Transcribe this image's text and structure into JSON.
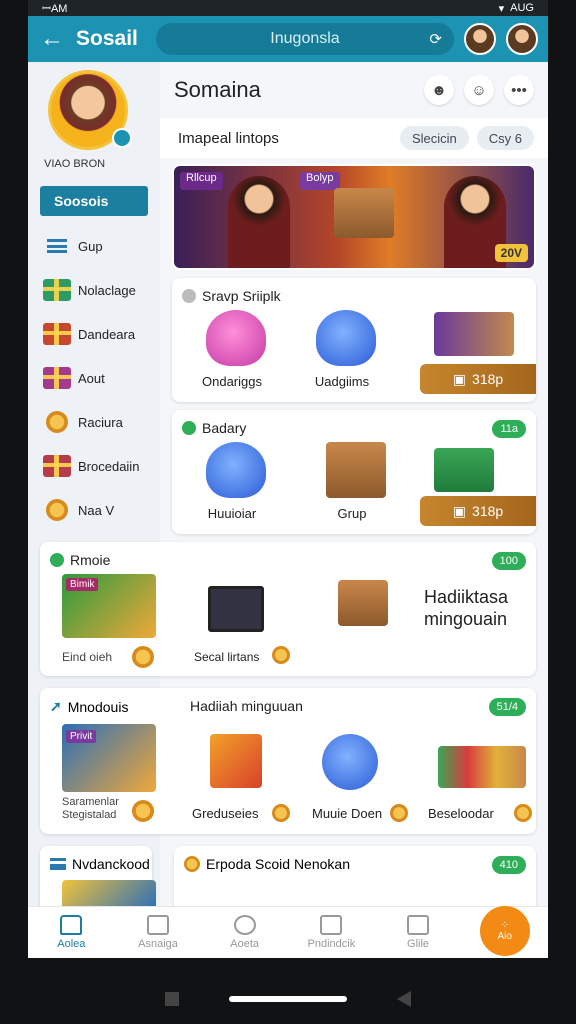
{
  "status": {
    "left": "ꟷAM",
    "right": "AUG"
  },
  "topbar": {
    "title": "Sosail",
    "search_text": "Inugonsla"
  },
  "sidebar": {
    "profile_name": "VIAO BRON",
    "selected": "Soosois",
    "items": [
      {
        "label": "Gup",
        "icon": "menu-icon"
      },
      {
        "label": "Nolaclage",
        "icon": "gift-icon",
        "color": "#2f9b64"
      },
      {
        "label": "Dandeara",
        "icon": "gift-icon",
        "color": "#c8482f"
      },
      {
        "label": "Aout",
        "icon": "gift-icon",
        "color": "#a33a8d"
      },
      {
        "label": "Raciura",
        "icon": "coin-icon",
        "color": "#e5a020"
      },
      {
        "label": "Brocedaiin",
        "icon": "gift-icon",
        "color": "#b73c4a"
      },
      {
        "label": "Naa V",
        "icon": "coin-icon",
        "color": "#e2a726"
      }
    ]
  },
  "main": {
    "title": "Somaina",
    "subhead_label": "Imapeal lintops",
    "pills": [
      "Slecicin",
      "Csy 6"
    ],
    "banner": {
      "tag1": "Rllcup",
      "tag2": "Bolyp",
      "count": "20V"
    }
  },
  "cards": [
    {
      "title": "Sravp Sriiplk",
      "items": [
        "Ondariggs",
        "Uadgiims"
      ],
      "price": "318p"
    },
    {
      "title": "Badary",
      "badge": "11a",
      "items": [
        "Huuioiar",
        "Grup"
      ],
      "price": "318p"
    }
  ],
  "sections": [
    {
      "title": "Rmoie",
      "badge": "100",
      "items": [
        "Eind oieh",
        "Secal lirtans"
      ],
      "side_title": "Hadiiktasa\nmingouain",
      "promo": "Bimik"
    },
    {
      "title": "Mnodouis",
      "center_title": "Hadiiah minguuan",
      "badge": "51/4",
      "items": [
        "Saramenlar\nStegistalad",
        "Greduseies",
        "Muuie Doen",
        "Beseloodar"
      ],
      "promo": "Privit"
    },
    {
      "title": "Nvdanckood",
      "center_title": "Erpoda Scoid Nenokan",
      "badge": "410"
    }
  ],
  "bottomnav": {
    "items": [
      "Aolea",
      "Asnaiga",
      "Aoeta",
      "Pndindcik",
      "Glile"
    ],
    "fab_label": "Aio"
  }
}
